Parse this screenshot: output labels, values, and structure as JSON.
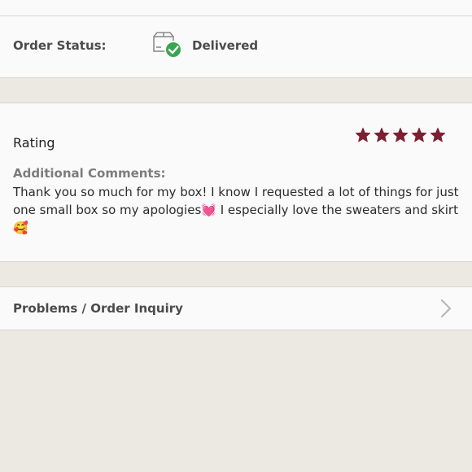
{
  "order_status": {
    "label": "Order Status:",
    "value": "Delivered",
    "icon": "package-delivered-icon",
    "check_color": "#3aa551"
  },
  "rating": {
    "title": "Rating",
    "stars": 5,
    "max_stars": 5,
    "star_color": "#7b2030",
    "comments_label": "Additional Comments:",
    "comments_text": "Thank you so much for my box! I know I requested a lot of things for just one small box so my apologies💓 I especially love the sweaters and skirt 🥰"
  },
  "inquiry": {
    "label": "Problems / Order Inquiry",
    "icon": "chevron-right-icon"
  }
}
